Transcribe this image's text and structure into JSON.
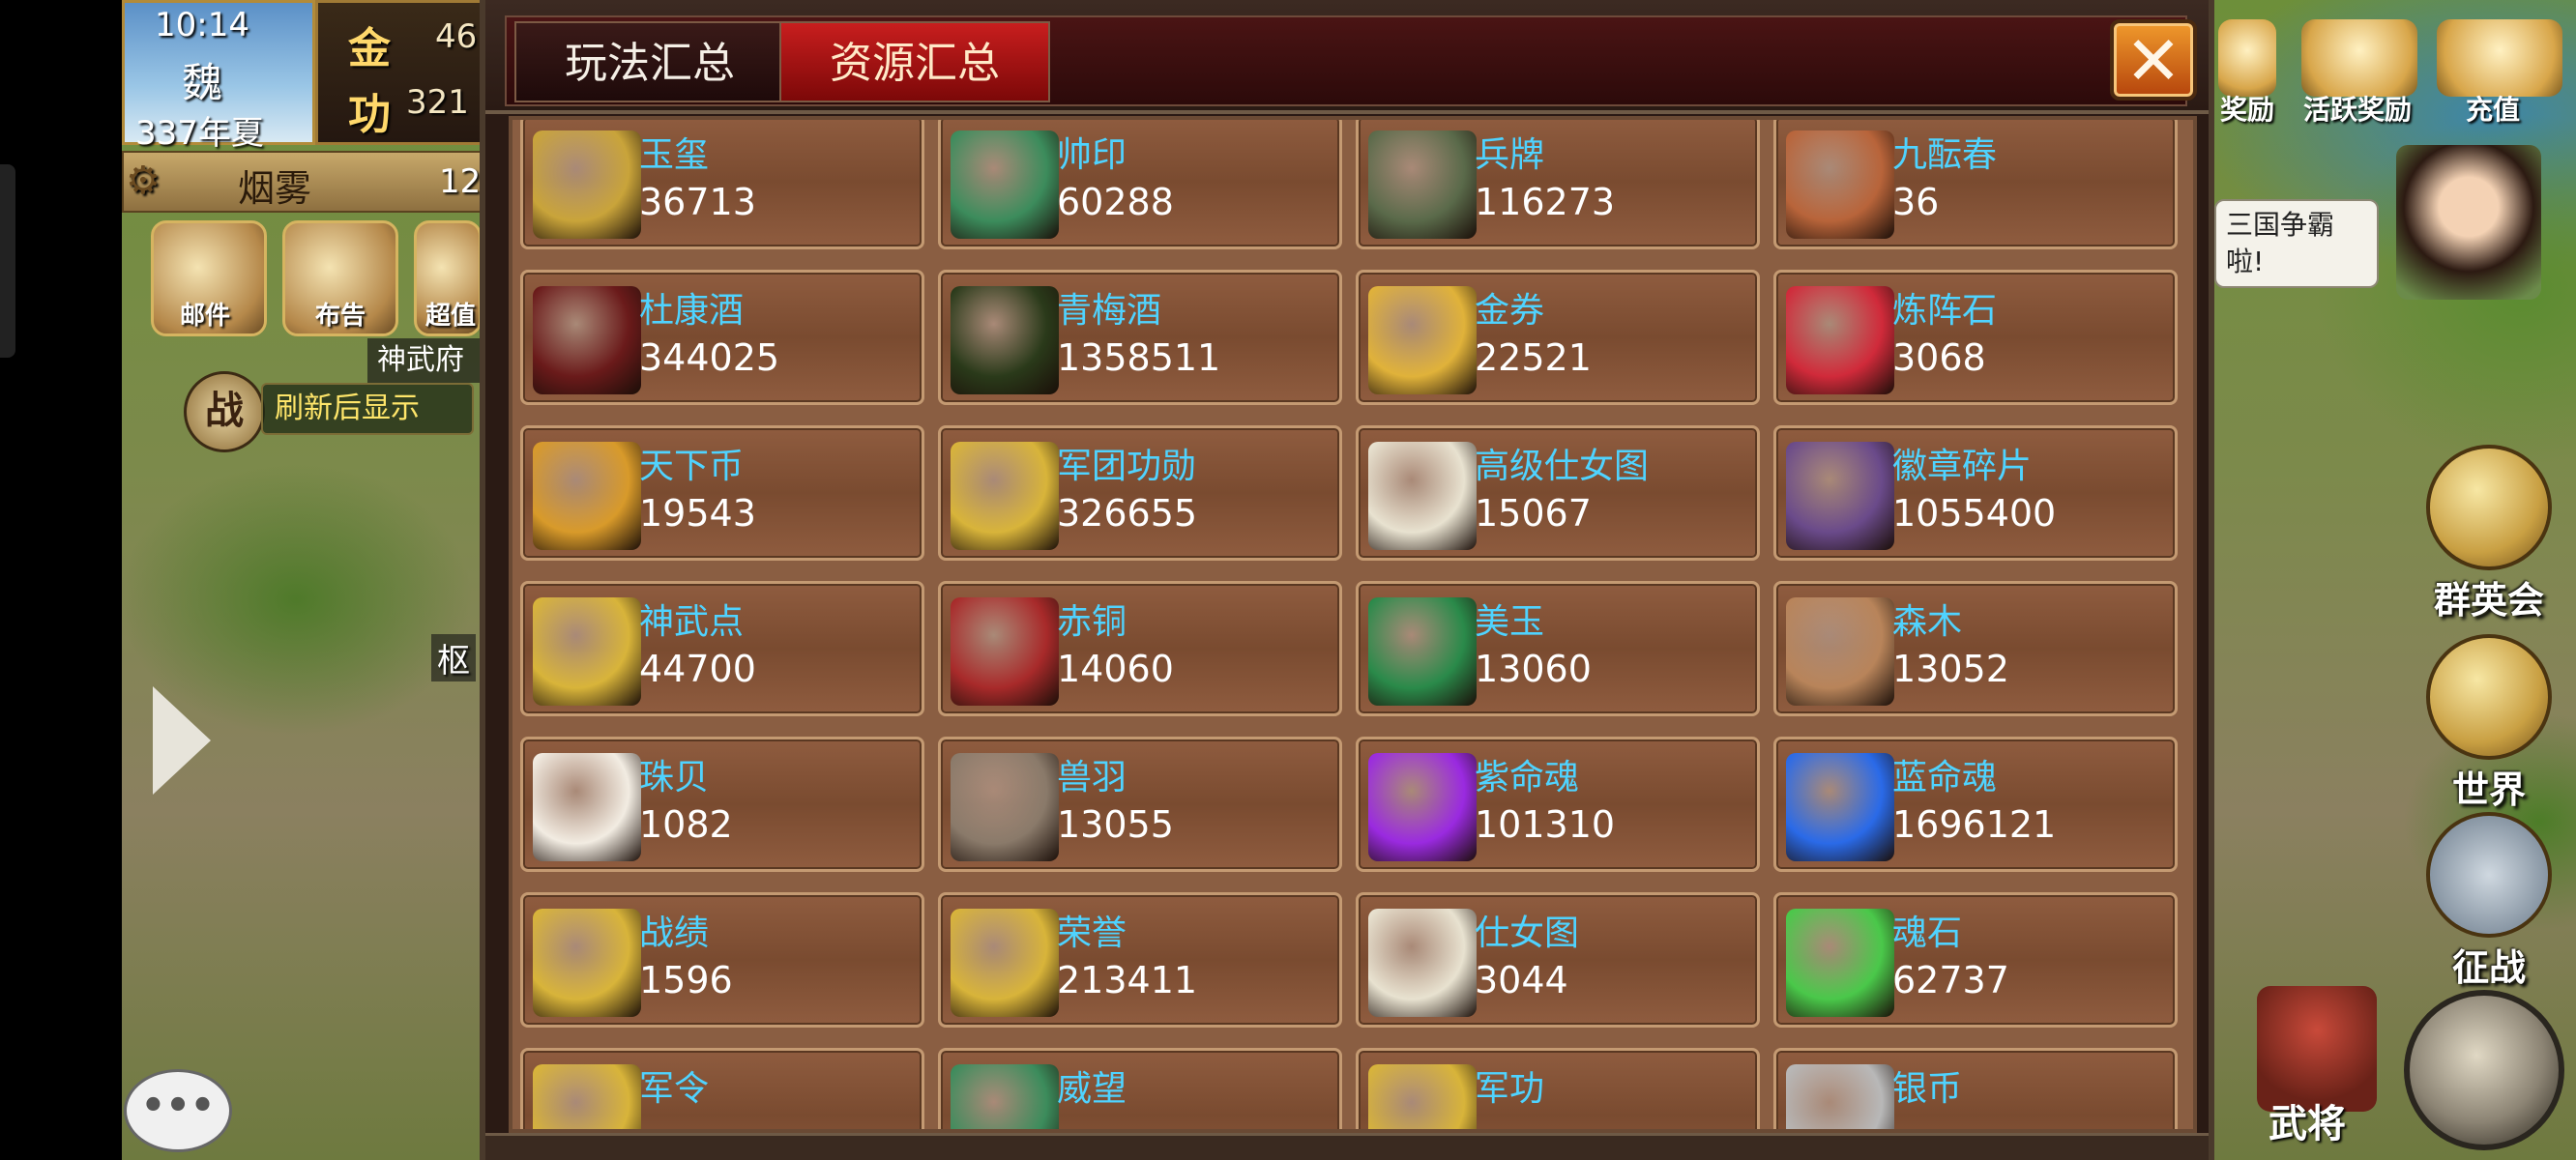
{
  "status": {
    "time": "10:14",
    "kingdom": "魏",
    "year_season": "337年夏",
    "gold_label": "金",
    "gold_value": "46",
    "merit_label": "功",
    "merit_value": "321",
    "weather": "烟雾",
    "weather_value": "12"
  },
  "left_menu": {
    "mail": "邮件",
    "notice": "布告",
    "super": "超值",
    "shenwu": "神武府",
    "refresh_hint": "刷新后显示",
    "war_icon": "战",
    "map_label": "枢"
  },
  "right_menu": {
    "reward": "奖励",
    "active_reward": "活跃奖励",
    "recharge": "充值",
    "speech": "三国争霸 啦!",
    "heroes": "群英会",
    "world": "世界",
    "campaign": "征战",
    "general": "武将"
  },
  "dialog": {
    "tabs": [
      {
        "label": "玩法汇总",
        "active": false
      },
      {
        "label": "资源汇总",
        "active": true
      }
    ],
    "close_glyph": "✕"
  },
  "resources": [
    {
      "name": "玉玺",
      "value": "36713",
      "icon": "jade-seal-icon",
      "color": "#c9a43a"
    },
    {
      "name": "帅印",
      "value": "60288",
      "icon": "marshal-seal-icon",
      "color": "#3c8c5c"
    },
    {
      "name": "兵牌",
      "value": "116273",
      "icon": "army-token-icon",
      "color": "#5a6a4a"
    },
    {
      "name": "九酝春",
      "value": "36",
      "icon": "wine-jar-icon",
      "color": "#b8643a"
    },
    {
      "name": "杜康酒",
      "value": "344025",
      "icon": "dukang-wine-icon",
      "color": "#6a1a1a"
    },
    {
      "name": "青梅酒",
      "value": "1358511",
      "icon": "plum-wine-icon",
      "color": "#2a3a1a"
    },
    {
      "name": "金券",
      "value": "22521",
      "icon": "gold-voucher-icon",
      "color": "#e0b23a"
    },
    {
      "name": "炼阵石",
      "value": "3068",
      "icon": "formation-stone-icon",
      "color": "#d02a3a"
    },
    {
      "name": "天下币",
      "value": "19543",
      "icon": "world-coin-icon",
      "color": "#d89a2a"
    },
    {
      "name": "军团功勋",
      "value": "326655",
      "icon": "legion-merit-icon",
      "color": "#d8b43a"
    },
    {
      "name": "高级仕女图",
      "value": "15067",
      "icon": "senior-scroll-icon",
      "color": "#e8e2d0"
    },
    {
      "name": "徽章碎片",
      "value": "1055400",
      "icon": "badge-fragment-icon",
      "color": "#6a4a8a"
    },
    {
      "name": "神武点",
      "value": "44700",
      "icon": "shenwu-point-icon",
      "color": "#d8b43a"
    },
    {
      "name": "赤铜",
      "value": "14060",
      "icon": "red-copper-icon",
      "color": "#a82a2a"
    },
    {
      "name": "美玉",
      "value": "13060",
      "icon": "jade-icon",
      "color": "#2a8a4a"
    },
    {
      "name": "森木",
      "value": "13052",
      "icon": "wood-icon",
      "color": "#b8845a"
    },
    {
      "name": "珠贝",
      "value": "1082",
      "icon": "pearl-icon",
      "color": "#f2ece2"
    },
    {
      "name": "兽羽",
      "value": "13055",
      "icon": "feather-icon",
      "color": "#8a7a6a"
    },
    {
      "name": "紫命魂",
      "value": "101310",
      "icon": "purple-soul-icon",
      "color": "#9a2ae0"
    },
    {
      "name": "蓝命魂",
      "value": "1696121",
      "icon": "blue-soul-icon",
      "color": "#2a6ae8"
    },
    {
      "name": "战绩",
      "value": "1596",
      "icon": "battle-record-icon",
      "color": "#d8b43a"
    },
    {
      "name": "荣誉",
      "value": "213411",
      "icon": "honor-icon",
      "color": "#d8b43a"
    },
    {
      "name": "仕女图",
      "value": "3044",
      "icon": "scroll-icon",
      "color": "#e8e2d0"
    },
    {
      "name": "魂石",
      "value": "62737",
      "icon": "soul-stone-icon",
      "color": "#4ac84a"
    },
    {
      "name": "军令",
      "value": "",
      "icon": "military-order-icon",
      "color": "#d8b43a"
    },
    {
      "name": "威望",
      "value": "",
      "icon": "prestige-icon",
      "color": "#3c8c5c"
    },
    {
      "name": "军功",
      "value": "",
      "icon": "military-merit-icon",
      "color": "#d8b43a"
    },
    {
      "name": "银币",
      "value": "",
      "icon": "silver-coin-icon",
      "color": "#b8b8b8"
    }
  ]
}
